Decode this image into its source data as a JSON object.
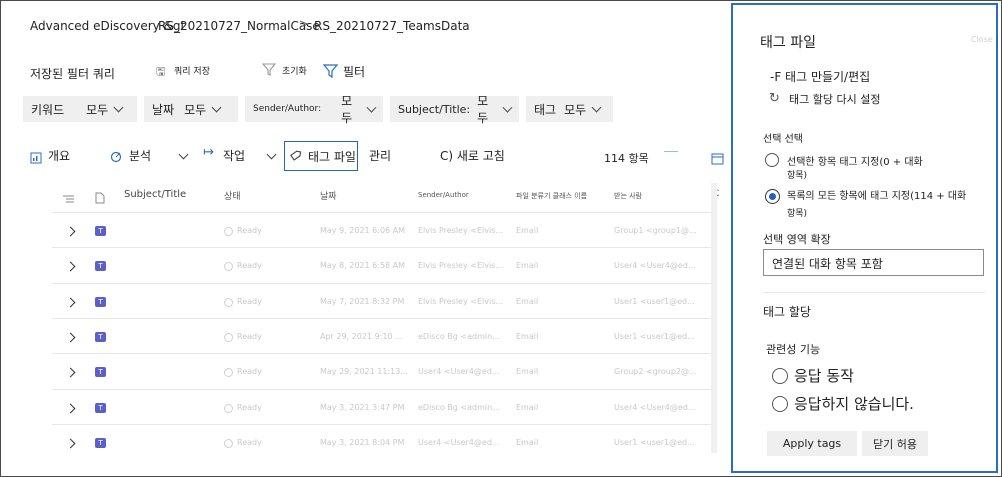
{
  "breadcrumb": {
    "items": [
      "Advanced eDiscovery &gt",
      "RS_20210727_NormalCase",
      "RS_20210727_TeamsData"
    ],
    "separator": ">"
  },
  "toolbar": {
    "saved_queries": "저장된 필터 쿼리",
    "save_query": "쿼리 저장",
    "reset": "초기화",
    "filter": "필터"
  },
  "filters": [
    {
      "label": "키워드",
      "value": "모두"
    },
    {
      "label": "날짜",
      "value": "모두"
    },
    {
      "label": "Sender/Author:",
      "value": "모두"
    },
    {
      "label": "Subject/Title:",
      "value": "모두"
    },
    {
      "label": "태그",
      "value": "모두"
    }
  ],
  "commands": {
    "overview": "개요",
    "analytics": "분석",
    "actions": "작업",
    "tag_files": "태그 파일",
    "manage": "관리",
    "refresh": "C) 새로 고침",
    "count": "114 항목"
  },
  "table": {
    "headers": [
      "Subject/Title",
      "상태",
      "날짜",
      "Sender/Author",
      "파일 분류기 클래스 이름",
      "받는 사람",
      "C"
    ],
    "rows": [
      {
        "status": "Ready",
        "date": "May 9, 2021 6:06 AM",
        "sender": "Elvis Presley <Elvis...",
        "class": "Email",
        "recipient": "Group1 <group1@..."
      },
      {
        "status": "Ready",
        "date": "May 8, 2021 6:58 AM",
        "sender": "Elvis Presley <Elvis...",
        "class": "Email",
        "recipient": "User4 <User4@ed..."
      },
      {
        "status": "Ready",
        "date": "May 7, 2021 8:32 PM",
        "sender": "Elvis Presley <Elvis...",
        "class": "Email",
        "recipient": "User1 <user1@ed..."
      },
      {
        "status": "Ready",
        "date": "Apr 29, 2021 9:10 ...",
        "sender": "eDisco Bg <admin...",
        "class": "Email",
        "recipient": "User1 <user1@ed..."
      },
      {
        "status": "Ready",
        "date": "May 29, 2021 11:13...",
        "sender": "User4 <User4@ed...",
        "class": "Email",
        "recipient": "Group2 <group2@..."
      },
      {
        "status": "Ready",
        "date": "May 3, 2021 3:47 PM",
        "sender": "eDisco Bg <admin...",
        "class": "Email",
        "recipient": "User4 <User4@ed..."
      },
      {
        "status": "Ready",
        "date": "May 3, 2021 8:04 PM",
        "sender": "User4 <User4@ed...",
        "class": "Email",
        "recipient": "User1 <user1@ed..."
      }
    ]
  },
  "panel": {
    "title": "태그 파일",
    "close": "Close",
    "create_edit": "-F 태그 만들기/편집",
    "reset_tags": "태그 할당 다시 설정",
    "selection_heading": "선택 선택",
    "option_selected": "선택한 항목 태그 지정(0 + 대화",
    "option_selected_2": "항목)",
    "option_all": "목록의 모든 항목에 태그 지정(114 + 대화",
    "option_all_2": "항목)",
    "expand_heading": "선택 영역 확장",
    "expand_value": "연결된 대화 항목 포함",
    "assign_heading": "태그 할당",
    "relevance_heading": "관련성 기능",
    "resp_yes": "응답 동작",
    "resp_no": "응답하지 않습니다.",
    "apply": "Apply tags",
    "close_btn": "닫기 허용",
    "accent": "#2d6cc6"
  }
}
